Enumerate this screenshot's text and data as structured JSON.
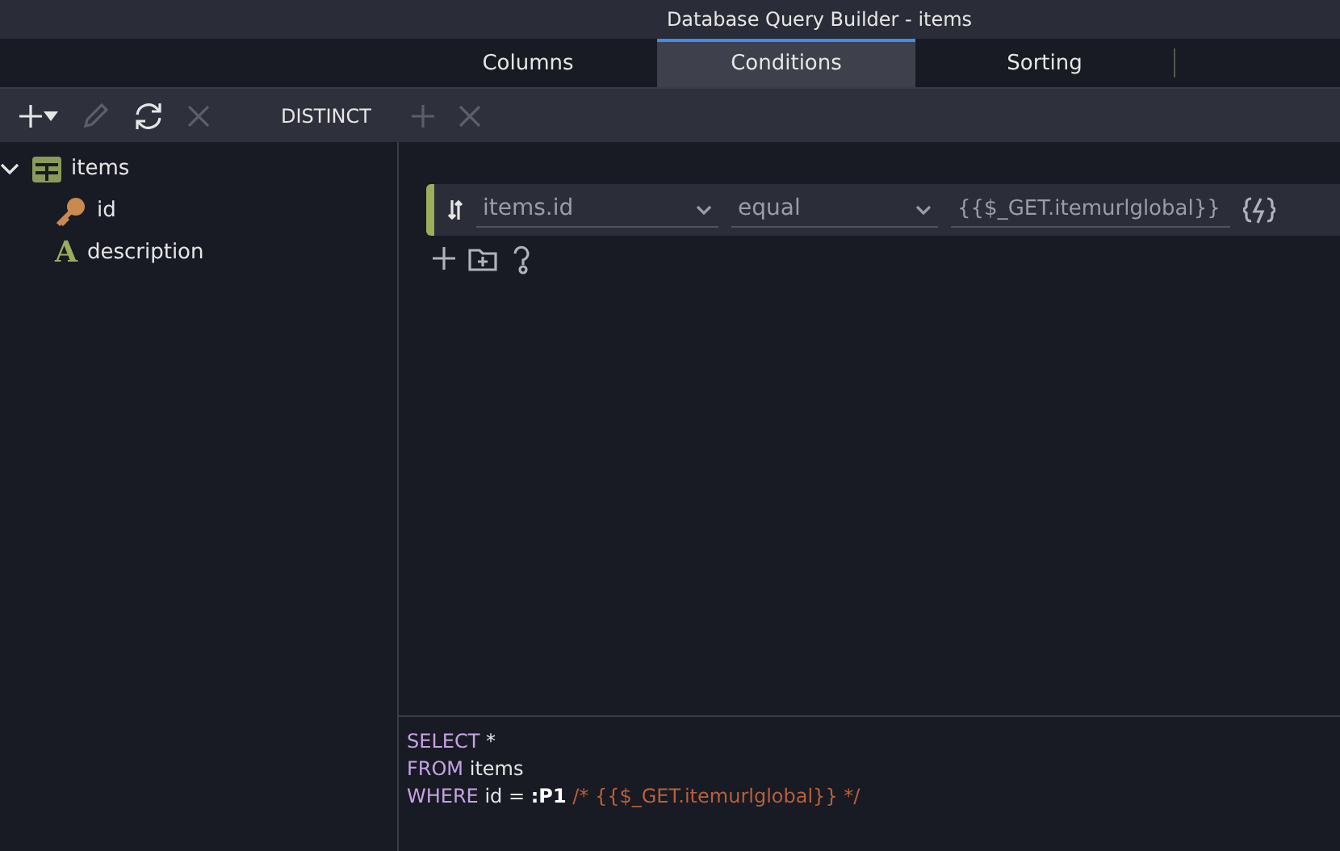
{
  "window": {
    "title": "Database Query Builder - items"
  },
  "tabs": [
    {
      "label": "Columns",
      "selected": false
    },
    {
      "label": "Conditions",
      "selected": true
    },
    {
      "label": "Sorting",
      "selected": false
    }
  ],
  "toolbar": [
    {
      "kind": "add",
      "disabled": false
    },
    {
      "kind": "edit",
      "disabled": true
    },
    {
      "kind": "refresh",
      "disabled": false
    },
    {
      "kind": "delete",
      "disabled": true
    },
    {
      "kind": "text",
      "label": "DISTINCT",
      "disabled": false
    },
    {
      "kind": "add",
      "disabled": true
    },
    {
      "kind": "delete",
      "disabled": true
    }
  ],
  "tree": [
    {
      "label": "items",
      "kind": "table",
      "expanded": true,
      "children": [
        {
          "label": "id",
          "kind": "key"
        },
        {
          "label": "description",
          "kind": "text",
          "glyph": "A"
        }
      ]
    }
  ],
  "conditions": [
    {
      "field": "items.id",
      "operator": "equal",
      "value": "{{$_GET.itemurlglobal}}"
    }
  ],
  "sql": [
    [
      {
        "kind": "keyword",
        "text": "SELECT"
      },
      {
        "kind": "ident",
        "text": " *"
      }
    ],
    [
      {
        "kind": "keyword",
        "text": "FROM"
      },
      {
        "kind": "ident",
        "text": " items"
      }
    ],
    [
      {
        "kind": "keyword",
        "text": "WHERE"
      },
      {
        "kind": "ident",
        "text": " id = "
      },
      {
        "kind": "param",
        "text": ":P1"
      },
      {
        "kind": "comment",
        "text": " /* {{$_GET.itemurlglobal}} */"
      }
    ]
  ]
}
